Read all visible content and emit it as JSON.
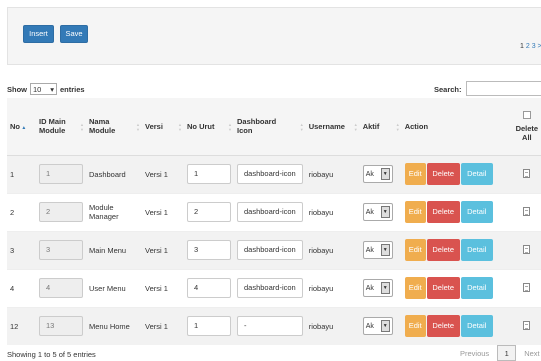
{
  "toolbar": {
    "insert_label": "Insert",
    "save_label": "Save"
  },
  "top_pager": {
    "current": "1",
    "pages": "2 3",
    "next": ">"
  },
  "length": {
    "show": "Show",
    "value": "10",
    "entries": "entries"
  },
  "search": {
    "label": "Search:"
  },
  "columns": {
    "no": "No",
    "id_main_module": "ID Main Module",
    "nama_module": "Nama Module",
    "versi": "Versi",
    "no_urut": "No Urut",
    "dashboard_icon": "Dashboard Icon",
    "username": "Username",
    "aktif": "Aktif",
    "action": "Action",
    "delete_all": "Delete All"
  },
  "rows": [
    {
      "no": "1",
      "id_main_module": "1",
      "nama_module": "Dashboard",
      "versi": "Versi 1",
      "no_urut": "1",
      "dashboard_icon": "dashboard-icon",
      "username": "riobayu",
      "aktif": "Ak"
    },
    {
      "no": "2",
      "id_main_module": "2",
      "nama_module": "Module Manager",
      "versi": "Versi 1",
      "no_urut": "2",
      "dashboard_icon": "dashboard-icon",
      "username": "riobayu",
      "aktif": "Ak"
    },
    {
      "no": "3",
      "id_main_module": "3",
      "nama_module": "Main Menu",
      "versi": "Versi 1",
      "no_urut": "3",
      "dashboard_icon": "dashboard-icon",
      "username": "riobayu",
      "aktif": "Ak"
    },
    {
      "no": "4",
      "id_main_module": "4",
      "nama_module": "User Menu",
      "versi": "Versi 1",
      "no_urut": "4",
      "dashboard_icon": "dashboard-icon",
      "username": "riobayu",
      "aktif": "Ak"
    },
    {
      "no": "12",
      "id_main_module": "13",
      "nama_module": "Menu Home",
      "versi": "Versi 1",
      "no_urut": "1",
      "dashboard_icon": "-",
      "username": "riobayu",
      "aktif": "Ak"
    }
  ],
  "actions": {
    "edit": "Edit",
    "delete": "Delete",
    "detail": "Detail"
  },
  "info": "Showing 1 to 5 of 5 entries",
  "pagination": {
    "previous": "Previous",
    "current": "1",
    "next": "Next"
  },
  "colors": {
    "primary": "#337ab7",
    "warning": "#f0ad4e",
    "danger": "#d9534f",
    "info": "#5bc0de"
  },
  "icons": {
    "sort": "sort-arrows-icon",
    "row_action": "document-icon",
    "select_dropdown": "dropdown-arrow-icon"
  }
}
